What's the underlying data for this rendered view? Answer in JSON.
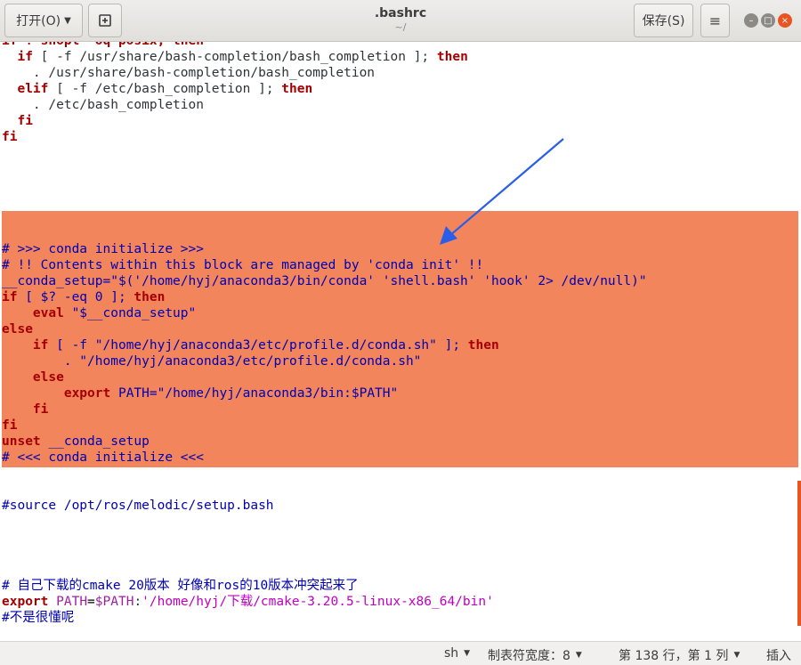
{
  "header": {
    "open_label": "打开(O)",
    "title": ".bashrc",
    "subtitle": "~/",
    "save_label": "保存(S)"
  },
  "icons": {
    "open_dropdown": "chevron-down-icon",
    "new_tab": "new-document-icon",
    "menu": "hamburger-menu-icon",
    "minimize": "minimize-icon",
    "maximize": "maximize-icon",
    "close": "close-icon"
  },
  "colors": {
    "selection": "#f3855d",
    "keyword": "#a40000",
    "comment": "#0000b0",
    "string": "#c000c0",
    "accent": "#e95420",
    "annotation_arrow": "#2a5ee8"
  },
  "editor": {
    "lines": [
      [
        {
          "t": "if ! shopt -oq posix; then",
          "c": "kw"
        }
      ],
      [
        {
          "t": "  "
        },
        {
          "t": "if",
          "c": "kw"
        },
        {
          "t": " [ -f /usr/share/bash-completion/bash_completion ]; ",
          "c": "pl"
        },
        {
          "t": "then",
          "c": "kw"
        }
      ],
      [
        {
          "t": "    . /usr/share/bash-completion/bash_completion",
          "c": "pl"
        }
      ],
      [
        {
          "t": "  "
        },
        {
          "t": "elif",
          "c": "kw"
        },
        {
          "t": " [ -f /etc/bash_completion ]; ",
          "c": "pl"
        },
        {
          "t": "then",
          "c": "kw"
        }
      ],
      [
        {
          "t": "    . /etc/bash_completion",
          "c": "pl"
        }
      ],
      [
        {
          "t": "  "
        },
        {
          "t": "fi",
          "c": "kw"
        }
      ],
      [
        {
          "t": "fi",
          "c": "kw"
        }
      ],
      [],
      [],
      [],
      [],
      [],
      [],
      [
        {
          "t": "# >>> conda initialize >>>",
          "c": "cm"
        }
      ],
      [
        {
          "t": "# !! Contents within this block are managed by 'conda init' !!",
          "c": "cm"
        }
      ],
      [
        {
          "t": "__conda_setup=\"$('/home/hyj/anaconda3/bin/conda' 'shell.bash' 'hook' 2> /dev/null)\"",
          "c": "cm"
        }
      ],
      [
        {
          "t": "if",
          "c": "kw"
        },
        {
          "t": " [ $? -eq 0 ]; ",
          "c": "cm"
        },
        {
          "t": "then",
          "c": "kw"
        }
      ],
      [
        {
          "t": "    "
        },
        {
          "t": "eval",
          "c": "kw"
        },
        {
          "t": " \"$__conda_setup\"",
          "c": "cm"
        }
      ],
      [
        {
          "t": "else",
          "c": "kw"
        }
      ],
      [
        {
          "t": "    "
        },
        {
          "t": "if",
          "c": "kw"
        },
        {
          "t": " [ -f \"/home/hyj/anaconda3/etc/profile.d/conda.sh\" ]; ",
          "c": "cm"
        },
        {
          "t": "then",
          "c": "kw"
        }
      ],
      [
        {
          "t": "        . \"/home/hyj/anaconda3/etc/profile.d/conda.sh\"",
          "c": "cm"
        }
      ],
      [
        {
          "t": "    "
        },
        {
          "t": "else",
          "c": "kw"
        }
      ],
      [
        {
          "t": "        "
        },
        {
          "t": "export",
          "c": "kw"
        },
        {
          "t": " PATH=\"/home/hyj/anaconda3/bin:$PATH\"",
          "c": "cm"
        }
      ],
      [
        {
          "t": "    "
        },
        {
          "t": "fi",
          "c": "kw"
        }
      ],
      [
        {
          "t": "fi",
          "c": "kw"
        }
      ],
      [
        {
          "t": "unset",
          "c": "kw"
        },
        {
          "t": " __conda_setup",
          "c": "cm"
        }
      ],
      [
        {
          "t": "# <<< conda initialize <<<",
          "c": "cm"
        }
      ],
      [],
      [],
      [
        {
          "t": "#source /opt/ros/melodic/setup.bash",
          "c": "cm"
        }
      ],
      [],
      [],
      [],
      [],
      [
        {
          "t": "# 自己下载的cmake 20版本 好像和ros的10版本冲突起来了",
          "c": "cm"
        }
      ],
      [
        {
          "t": "export",
          "c": "kw"
        },
        {
          "t": " "
        },
        {
          "t": "PATH",
          "c": "vr"
        },
        {
          "t": "="
        },
        {
          "t": "$PATH",
          "c": "vr"
        },
        {
          "t": ":",
          "c": "pl"
        },
        {
          "t": "'/home/hyj/下载/cmake-3.20.5-linux-x86_64/bin'",
          "c": "st"
        }
      ],
      [
        {
          "t": "#不是很懂呢",
          "c": "cm"
        }
      ]
    ]
  },
  "statusbar": {
    "language": "sh",
    "tab_width": "制表符宽度：8",
    "position": "第 138 行，第 1 列",
    "mode": "插入"
  }
}
